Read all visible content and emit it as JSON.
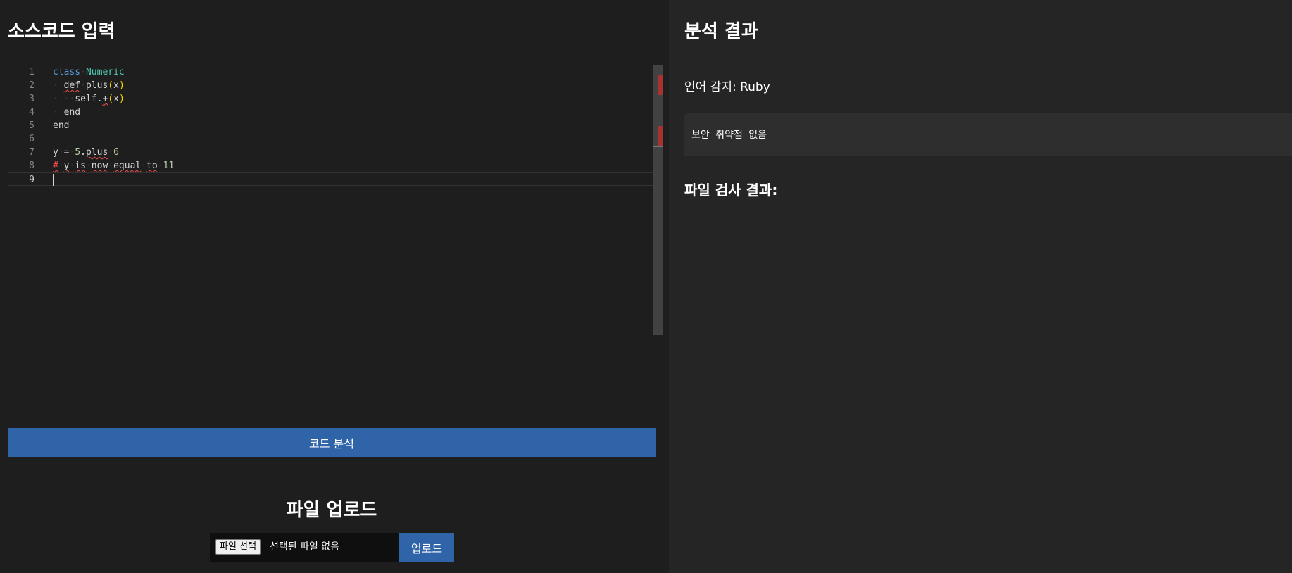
{
  "left": {
    "title": "소스코드 입력",
    "analyze_button": "코드 분석",
    "upload": {
      "title": "파일 업로드",
      "choose_file": "파일 선택",
      "no_file": "선택된 파일 없음",
      "upload_button": "업로드"
    }
  },
  "editor": {
    "line_numbers": [
      "1",
      "2",
      "3",
      "4",
      "5",
      "6",
      "7",
      "8",
      "9"
    ],
    "lines": [
      "class Numeric",
      "  def plus(x)",
      "    self.+(x)",
      "  end",
      "end",
      "",
      "y = 5.plus 6",
      "# y is now equal to 11",
      ""
    ],
    "current_line": 9
  },
  "right": {
    "title": "분석 결과",
    "language_detect": "언어 감지: Ruby",
    "result_message": "보안 취약점 없음",
    "file_result_title": "파일 검사 결과:"
  },
  "colors": {
    "button": "#3064a8",
    "background": "#1e1e1e",
    "panel": "#252525"
  }
}
